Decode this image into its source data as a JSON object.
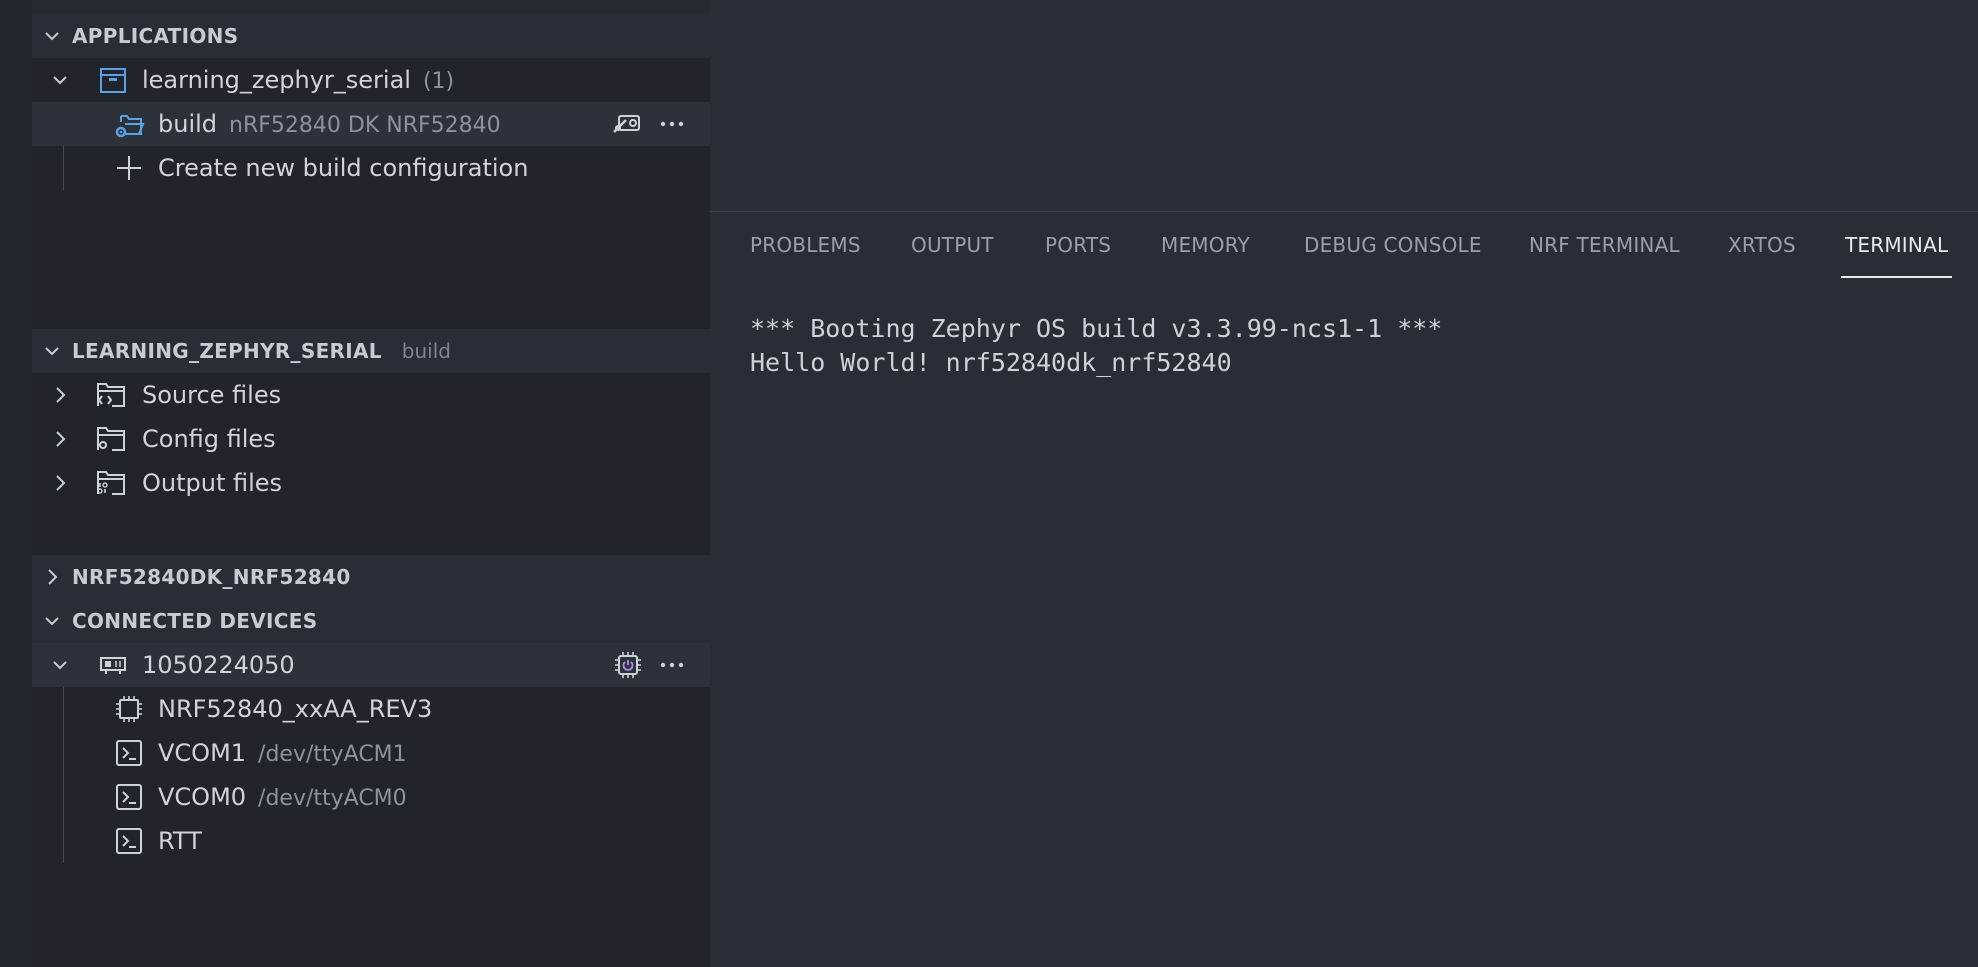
{
  "sidebar": {
    "applications": {
      "title": "APPLICATIONS",
      "app": {
        "name": "learning_zephyr_serial",
        "count": "(1)"
      },
      "build": {
        "label": "build",
        "description": "nRF52840 DK NRF52840"
      },
      "create": {
        "label": "Create new build configuration"
      }
    },
    "details": {
      "title": "LEARNING_ZEPHYR_SERIAL",
      "subtitle": "build",
      "items": [
        {
          "label": "Source files",
          "icon": "source-folder-icon"
        },
        {
          "label": "Config files",
          "icon": "config-folder-icon"
        },
        {
          "label": "Output files",
          "icon": "output-folder-icon"
        }
      ]
    },
    "board": {
      "title": "NRF52840DK_NRF52840"
    },
    "devices": {
      "title": "CONNECTED DEVICES",
      "device": {
        "serial": "1050224050"
      },
      "children": [
        {
          "label": "NRF52840_xxAA_REV3",
          "description": "",
          "icon": "chip-icon"
        },
        {
          "label": "VCOM1",
          "description": "/dev/ttyACM1",
          "icon": "terminal-icon"
        },
        {
          "label": "VCOM0",
          "description": "/dev/ttyACM0",
          "icon": "terminal-icon"
        },
        {
          "label": "RTT",
          "description": "",
          "icon": "terminal-icon"
        }
      ]
    }
  },
  "panel": {
    "tabs": [
      "PROBLEMS",
      "OUTPUT",
      "PORTS",
      "MEMORY",
      "DEBUG CONSOLE",
      "NRF TERMINAL",
      "XRTOS",
      "TERMINAL"
    ],
    "active_tab": "TERMINAL",
    "terminal_lines": [
      "*** Booting Zephyr OS build v3.3.99-ncs1-1 ***",
      "Hello World! nrf52840dk_nrf52840"
    ]
  },
  "colors": {
    "sidebar_bg": "#21252b",
    "section_header_bg": "#292d35",
    "panel_bg": "#292d35",
    "selected_row_bg": "#2c313a",
    "accent_blue": "#5aa1e6",
    "accent_purple": "#b08cf0"
  }
}
